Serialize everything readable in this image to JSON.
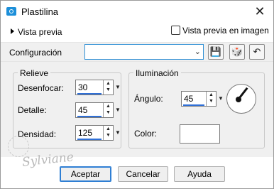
{
  "window": {
    "title": "Plastilina",
    "close_glyph": "✕",
    "icon": "app-icon"
  },
  "preview": {
    "toggle_label": "Vista previa",
    "checkbox_label": "Vista previa en imagen",
    "checked": false
  },
  "config": {
    "label": "Configuración",
    "selected_value": "",
    "buttons": [
      {
        "name": "save-preset",
        "glyph": "💾"
      },
      {
        "name": "randomize",
        "glyph": "🎲"
      },
      {
        "name": "reset",
        "glyph": "↶"
      }
    ]
  },
  "relieve": {
    "title": "Relieve",
    "fields": [
      {
        "label": "Desenfocar:",
        "value": "30"
      },
      {
        "label": "Detalle:",
        "value": "45"
      },
      {
        "label": "Densidad:",
        "value": "125"
      }
    ]
  },
  "iluminacion": {
    "title": "Iluminación",
    "angle_label": "Ángulo:",
    "angle_value": "45",
    "color_label": "Color:",
    "color_value": "#ffffff"
  },
  "watermark": "Sylviane",
  "buttons": {
    "accept": "Aceptar",
    "cancel": "Cancelar",
    "help": "Ayuda"
  },
  "colors": {
    "accent": "#2f7fd4",
    "app_icon": "#1c8fd9",
    "panel_bg": "#f0f0f0"
  }
}
